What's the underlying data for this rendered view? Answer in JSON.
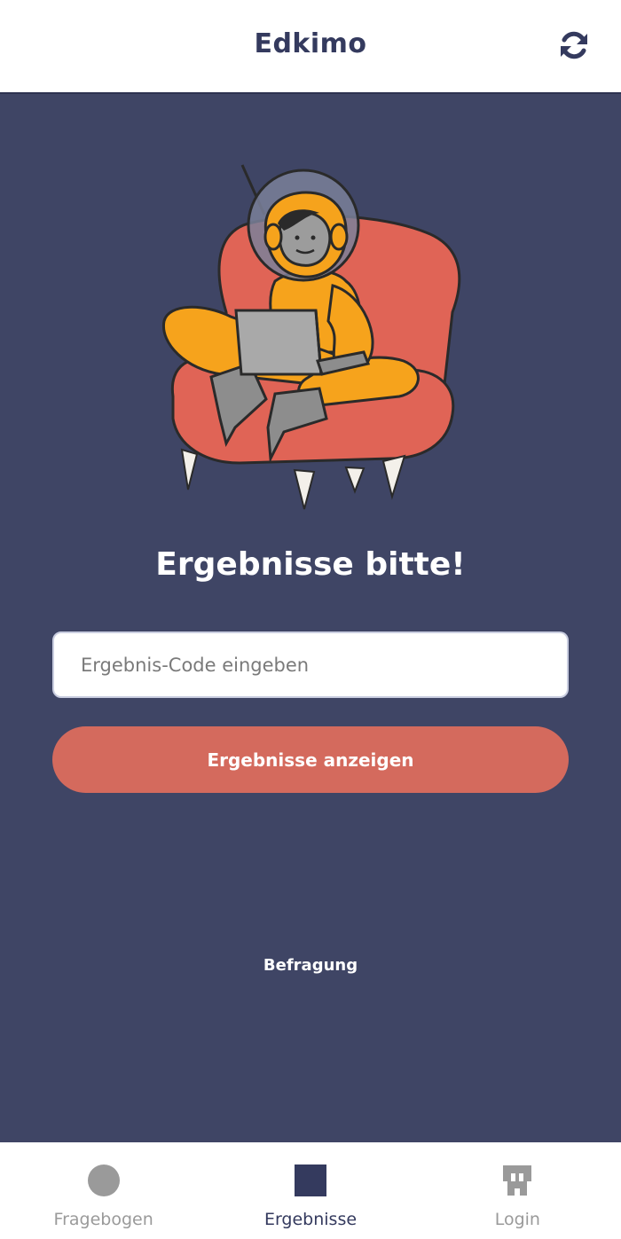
{
  "header": {
    "title": "Edkimo",
    "refresh_icon": "refresh-icon"
  },
  "main": {
    "illustration": "astronaut-on-armchair-with-laptop",
    "heading": "Ergebnisse bitte!",
    "code_input": {
      "value": "",
      "placeholder": "Ergebnis-Code eingeben"
    },
    "submit_label": "Ergebnisse anzeigen",
    "survey_link": "Befragung"
  },
  "nav": {
    "items": [
      {
        "label": "Fragebogen",
        "icon": "circle-icon",
        "active": false
      },
      {
        "label": "Ergebnisse",
        "icon": "square-icon",
        "active": true
      },
      {
        "label": "Login",
        "icon": "pixel-invader-icon",
        "active": false
      }
    ]
  },
  "colors": {
    "primary": "#343a5e",
    "background": "#3f4565",
    "accent": "#d46a5d",
    "inactive": "#9a9a9a"
  }
}
